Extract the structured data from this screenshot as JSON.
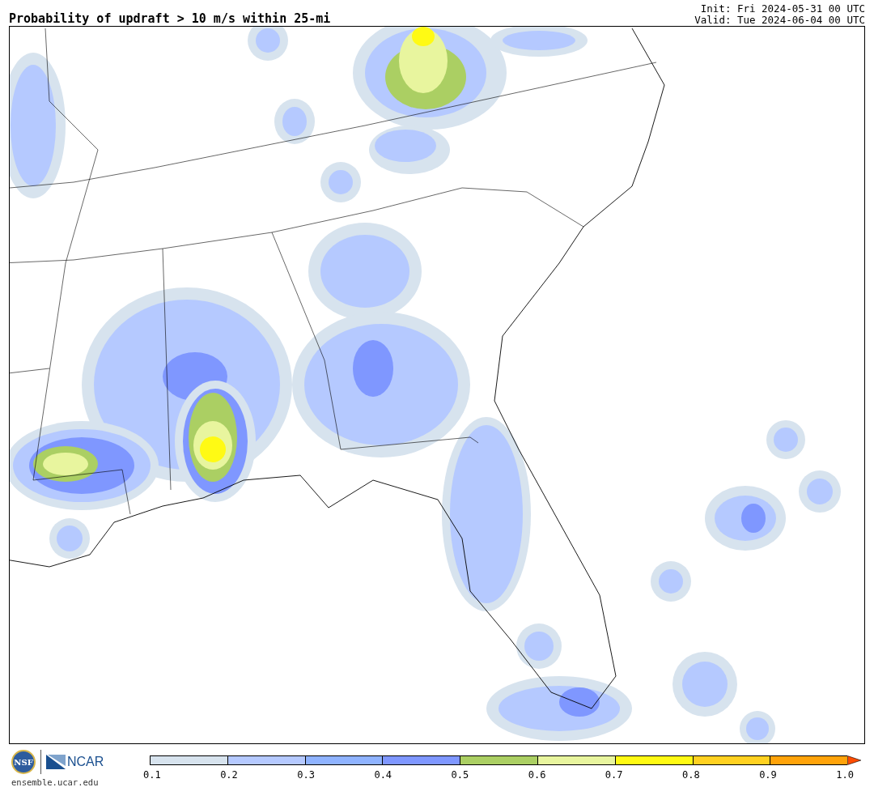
{
  "header": {
    "title": "Probability of updraft > 10 m/s within 25-mi",
    "init": "Init: Fri 2024-05-31 00 UTC",
    "valid": "Valid: Tue 2024-06-04 00 UTC"
  },
  "footer": {
    "nsf_logo": "NSF",
    "ncar_logo": "NCAR",
    "site": "ensemble.ucar.edu"
  },
  "colorbar": {
    "bins": [
      {
        "color": "#d7e3ee"
      },
      {
        "color": "#b5c9ff"
      },
      {
        "color": "#8fb3ff"
      },
      {
        "color": "#7f97ff"
      },
      {
        "color": "#abcf63"
      },
      {
        "color": "#e8f59e"
      },
      {
        "color": "#fffa14"
      },
      {
        "color": "#ffd121"
      },
      {
        "color": "#ffa30a"
      },
      {
        "color": "#ff4c00"
      }
    ],
    "ticks": [
      "0.1",
      "0.2",
      "0.3",
      "0.4",
      "0.5",
      "0.6",
      "0.7",
      "0.8",
      "0.9",
      "1.0"
    ]
  }
}
